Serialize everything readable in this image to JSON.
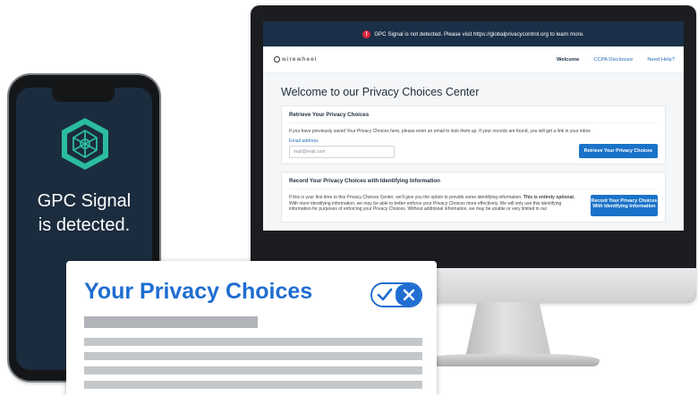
{
  "website": {
    "gpc_banner": "GPC Signal is not detected. Please visit https://globalprivacycontrol.org to learn more.",
    "logo_text": "wirewheel",
    "nav": [
      "Welcome",
      "CCPA Disclosure",
      "Need Help?"
    ],
    "page_title": "Welcome to our Privacy Choices Center",
    "retrieve": {
      "title": "Retrieve Your Privacy Choices",
      "description": "If you have previously saved Your Privacy Choices here, please enter an email to look them up. If your records are found, you will get a link in your inbox",
      "email_label": "Email address",
      "email_placeholder": "mail@mail.com",
      "button": "Retrieve Your Privacy Choices"
    },
    "record": {
      "title": "Record Your Privacy Choices with Identifying Information",
      "description_start": "If this is your first time to this Privacy Choices Center, we'll give you the option to provide some identifying information.",
      "description_bold": "This is entirely optional.",
      "description_end": "With more identifying information, we may be able to better enforce your Privacy Choices more effectively. We will only use this identifying information for purposes of enforcing your Privacy Choices. Without additional information, we may be unable or very limited in our",
      "button": "Record Your Privacy Choices With Identifying Information"
    }
  },
  "phone": {
    "message_line1": "GPC Signal",
    "message_line2": "is detected."
  },
  "privacy_card": {
    "title": "Your Privacy Choices",
    "toggle_check": "✓",
    "toggle_x": "✕"
  },
  "colors": {
    "brand_blue": "#1f6dd1",
    "button_blue": "#1a73c9",
    "header_navy": "#1a3048",
    "phone_screen": "#1b2c3e",
    "gpc_teal": "#2bbca0",
    "alert_red": "#d7263d"
  },
  "icons": [
    "warning-icon",
    "wirewheel-logo-icon",
    "gpc-shield-icon",
    "check-icon",
    "close-icon"
  ]
}
